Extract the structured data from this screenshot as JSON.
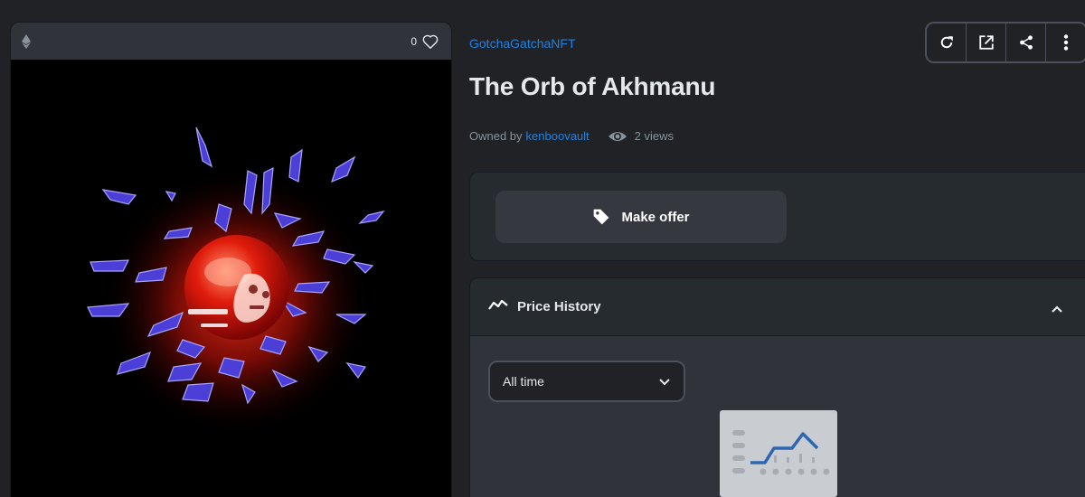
{
  "media": {
    "favorite_count": "0"
  },
  "item": {
    "collection": "GotchaGatchaNFT",
    "title": "The Orb of Akhmanu",
    "owned_by_label": "Owned by",
    "owner": "kenboovault",
    "views": "2 views"
  },
  "toolbar": {
    "refresh_icon": "refresh-icon",
    "external_icon": "external-link-icon",
    "share_icon": "share-icon",
    "more_icon": "more-vertical-icon"
  },
  "offer": {
    "button_label": "Make offer",
    "icon": "tag-icon"
  },
  "price_history": {
    "title": "Price History",
    "range_selected": "All time",
    "icon": "trending-line-icon"
  },
  "colors": {
    "background": "#202225",
    "panel": "#262b2f",
    "accent_link": "#2081e2",
    "border": "#4c505c"
  }
}
